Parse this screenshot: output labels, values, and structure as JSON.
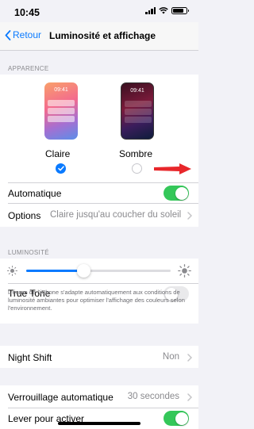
{
  "status_bar": {
    "time": "10:45"
  },
  "nav": {
    "back_label": "Retour",
    "title": "Luminosité et affichage"
  },
  "appearance": {
    "section_label": "APPARENCE",
    "light": {
      "preview_time": "09:41",
      "label": "Claire",
      "selected": true
    },
    "dark": {
      "preview_time": "09:41",
      "label": "Sombre",
      "selected": false
    },
    "automatic_label": "Automatique",
    "automatic_on": true,
    "options_label": "Options",
    "options_value": "Claire jusqu'au coucher du soleil"
  },
  "brightness": {
    "section_label": "LUMINOSITÉ",
    "level": 0.4,
    "true_tone_label": "True Tone",
    "true_tone_on": false,
    "true_tone_note": "L'écran de l'iPhone s'adapte automatiquement aux conditions de luminosité ambiantes pour optimiser l'affichage des couleurs selon l'environnement."
  },
  "night_shift": {
    "label": "Night Shift",
    "value": "Non"
  },
  "auto_lock": {
    "label": "Verrouillage automatique",
    "value": "30 secondes"
  },
  "raise_to_wake": {
    "label": "Lever pour activer",
    "on": true
  },
  "colors": {
    "accent": "#0a7aff",
    "toggle_on": "#34c759",
    "annotation_arrow": "#e8272b"
  }
}
